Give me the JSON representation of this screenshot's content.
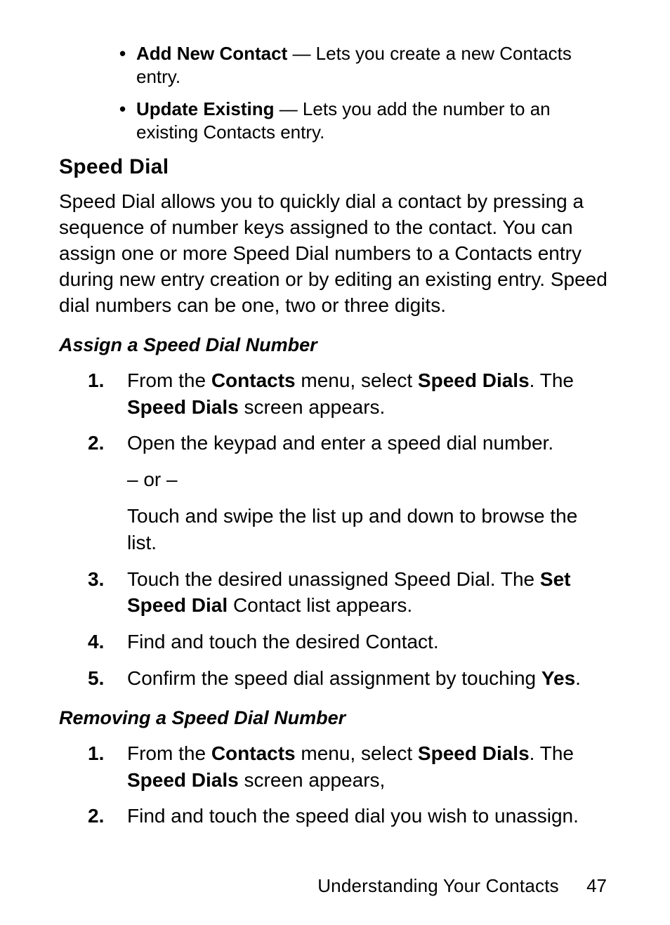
{
  "bullets": [
    {
      "bold": "Add New Contact",
      "rest": " — Lets you create a new Contacts entry."
    },
    {
      "bold": "Update Existing",
      "rest": " — Lets you add the number to an existing Contacts entry."
    }
  ],
  "heading": "Speed Dial",
  "intro": "Speed Dial allows you to quickly dial a contact by pressing a sequence of number keys assigned to the contact. You can assign one or more Speed Dial numbers to a Contacts entry during new entry creation or by editing an existing entry. Speed dial numbers can be one, two or three digits.",
  "section1": {
    "title": "Assign a Speed Dial Number",
    "steps": [
      {
        "num": "1.",
        "parts": [
          {
            "t": "From the "
          },
          {
            "t": "Contacts",
            "b": true
          },
          {
            "t": " menu, select "
          },
          {
            "t": "Speed Dials",
            "b": true
          },
          {
            "t": ". The "
          },
          {
            "t": "Speed Dials",
            "b": true
          },
          {
            "t": " screen appears."
          }
        ]
      },
      {
        "num": "2.",
        "parts": [
          {
            "t": "Open the keypad and enter a speed dial number."
          }
        ],
        "or": "– or –",
        "sub": "Touch and swipe the list up and down to browse the list."
      },
      {
        "num": "3.",
        "parts": [
          {
            "t": "Touch the desired unassigned Speed Dial. The "
          },
          {
            "t": "Set Speed Dial",
            "b": true
          },
          {
            "t": " Contact list appears."
          }
        ]
      },
      {
        "num": "4.",
        "parts": [
          {
            "t": "Find and touch the desired Contact."
          }
        ]
      },
      {
        "num": "5.",
        "parts": [
          {
            "t": "Confirm the speed dial assignment by touching "
          },
          {
            "t": "Yes",
            "b": true
          },
          {
            "t": "."
          }
        ]
      }
    ]
  },
  "section2": {
    "title": "Removing a Speed Dial Number",
    "steps": [
      {
        "num": "1.",
        "parts": [
          {
            "t": "From the "
          },
          {
            "t": "Contacts",
            "b": true
          },
          {
            "t": " menu, select "
          },
          {
            "t": "Speed Dials",
            "b": true
          },
          {
            "t": ". The "
          },
          {
            "t": "Speed Dials",
            "b": true
          },
          {
            "t": " screen appears,"
          }
        ]
      },
      {
        "num": "2.",
        "parts": [
          {
            "t": "Find and touch the speed dial you wish to unassign."
          }
        ]
      }
    ]
  },
  "footer": {
    "section": "Understanding Your Contacts",
    "page": "47"
  }
}
